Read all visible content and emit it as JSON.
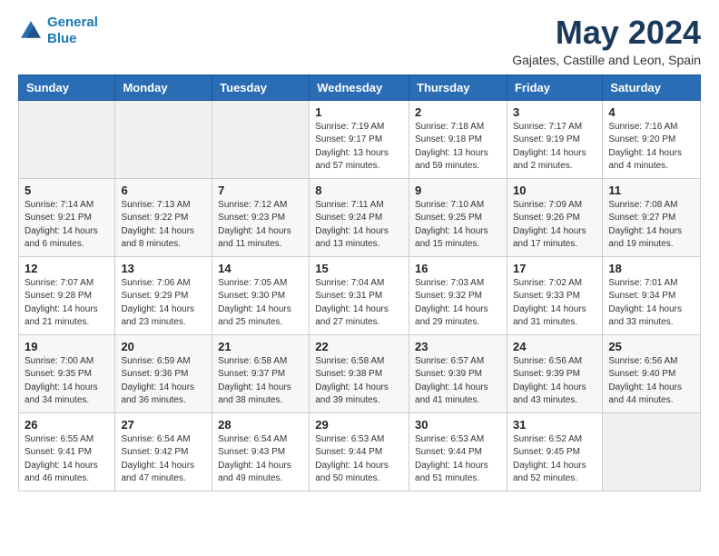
{
  "header": {
    "logo_line1": "General",
    "logo_line2": "Blue",
    "title": "May 2024",
    "subtitle": "Gajates, Castille and Leon, Spain"
  },
  "weekdays": [
    "Sunday",
    "Monday",
    "Tuesday",
    "Wednesday",
    "Thursday",
    "Friday",
    "Saturday"
  ],
  "weeks": [
    [
      {
        "day": "",
        "info": ""
      },
      {
        "day": "",
        "info": ""
      },
      {
        "day": "",
        "info": ""
      },
      {
        "day": "1",
        "info": "Sunrise: 7:19 AM\nSunset: 9:17 PM\nDaylight: 13 hours\nand 57 minutes."
      },
      {
        "day": "2",
        "info": "Sunrise: 7:18 AM\nSunset: 9:18 PM\nDaylight: 13 hours\nand 59 minutes."
      },
      {
        "day": "3",
        "info": "Sunrise: 7:17 AM\nSunset: 9:19 PM\nDaylight: 14 hours\nand 2 minutes."
      },
      {
        "day": "4",
        "info": "Sunrise: 7:16 AM\nSunset: 9:20 PM\nDaylight: 14 hours\nand 4 minutes."
      }
    ],
    [
      {
        "day": "5",
        "info": "Sunrise: 7:14 AM\nSunset: 9:21 PM\nDaylight: 14 hours\nand 6 minutes."
      },
      {
        "day": "6",
        "info": "Sunrise: 7:13 AM\nSunset: 9:22 PM\nDaylight: 14 hours\nand 8 minutes."
      },
      {
        "day": "7",
        "info": "Sunrise: 7:12 AM\nSunset: 9:23 PM\nDaylight: 14 hours\nand 11 minutes."
      },
      {
        "day": "8",
        "info": "Sunrise: 7:11 AM\nSunset: 9:24 PM\nDaylight: 14 hours\nand 13 minutes."
      },
      {
        "day": "9",
        "info": "Sunrise: 7:10 AM\nSunset: 9:25 PM\nDaylight: 14 hours\nand 15 minutes."
      },
      {
        "day": "10",
        "info": "Sunrise: 7:09 AM\nSunset: 9:26 PM\nDaylight: 14 hours\nand 17 minutes."
      },
      {
        "day": "11",
        "info": "Sunrise: 7:08 AM\nSunset: 9:27 PM\nDaylight: 14 hours\nand 19 minutes."
      }
    ],
    [
      {
        "day": "12",
        "info": "Sunrise: 7:07 AM\nSunset: 9:28 PM\nDaylight: 14 hours\nand 21 minutes."
      },
      {
        "day": "13",
        "info": "Sunrise: 7:06 AM\nSunset: 9:29 PM\nDaylight: 14 hours\nand 23 minutes."
      },
      {
        "day": "14",
        "info": "Sunrise: 7:05 AM\nSunset: 9:30 PM\nDaylight: 14 hours\nand 25 minutes."
      },
      {
        "day": "15",
        "info": "Sunrise: 7:04 AM\nSunset: 9:31 PM\nDaylight: 14 hours\nand 27 minutes."
      },
      {
        "day": "16",
        "info": "Sunrise: 7:03 AM\nSunset: 9:32 PM\nDaylight: 14 hours\nand 29 minutes."
      },
      {
        "day": "17",
        "info": "Sunrise: 7:02 AM\nSunset: 9:33 PM\nDaylight: 14 hours\nand 31 minutes."
      },
      {
        "day": "18",
        "info": "Sunrise: 7:01 AM\nSunset: 9:34 PM\nDaylight: 14 hours\nand 33 minutes."
      }
    ],
    [
      {
        "day": "19",
        "info": "Sunrise: 7:00 AM\nSunset: 9:35 PM\nDaylight: 14 hours\nand 34 minutes."
      },
      {
        "day": "20",
        "info": "Sunrise: 6:59 AM\nSunset: 9:36 PM\nDaylight: 14 hours\nand 36 minutes."
      },
      {
        "day": "21",
        "info": "Sunrise: 6:58 AM\nSunset: 9:37 PM\nDaylight: 14 hours\nand 38 minutes."
      },
      {
        "day": "22",
        "info": "Sunrise: 6:58 AM\nSunset: 9:38 PM\nDaylight: 14 hours\nand 39 minutes."
      },
      {
        "day": "23",
        "info": "Sunrise: 6:57 AM\nSunset: 9:39 PM\nDaylight: 14 hours\nand 41 minutes."
      },
      {
        "day": "24",
        "info": "Sunrise: 6:56 AM\nSunset: 9:39 PM\nDaylight: 14 hours\nand 43 minutes."
      },
      {
        "day": "25",
        "info": "Sunrise: 6:56 AM\nSunset: 9:40 PM\nDaylight: 14 hours\nand 44 minutes."
      }
    ],
    [
      {
        "day": "26",
        "info": "Sunrise: 6:55 AM\nSunset: 9:41 PM\nDaylight: 14 hours\nand 46 minutes."
      },
      {
        "day": "27",
        "info": "Sunrise: 6:54 AM\nSunset: 9:42 PM\nDaylight: 14 hours\nand 47 minutes."
      },
      {
        "day": "28",
        "info": "Sunrise: 6:54 AM\nSunset: 9:43 PM\nDaylight: 14 hours\nand 49 minutes."
      },
      {
        "day": "29",
        "info": "Sunrise: 6:53 AM\nSunset: 9:44 PM\nDaylight: 14 hours\nand 50 minutes."
      },
      {
        "day": "30",
        "info": "Sunrise: 6:53 AM\nSunset: 9:44 PM\nDaylight: 14 hours\nand 51 minutes."
      },
      {
        "day": "31",
        "info": "Sunrise: 6:52 AM\nSunset: 9:45 PM\nDaylight: 14 hours\nand 52 minutes."
      },
      {
        "day": "",
        "info": ""
      }
    ]
  ]
}
